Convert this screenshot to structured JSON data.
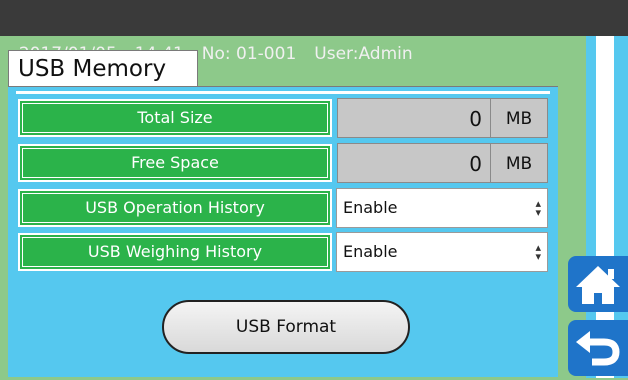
{
  "header": {
    "date": "2017/01/05",
    "time": "14:41",
    "number": "No: 01-001",
    "user": "User:Admin"
  },
  "tab": {
    "label": "USB Memory"
  },
  "fields": {
    "total_size": {
      "label": "Total Size",
      "value": "0",
      "unit": "MB"
    },
    "free_space": {
      "label": "Free Space",
      "value": "0",
      "unit": "MB"
    },
    "operation_history": {
      "label": "USB Operation History",
      "value": "Enable"
    },
    "weighing_history": {
      "label": "USB Weighing History",
      "value": "Enable"
    }
  },
  "format_button": {
    "label": "USB Format"
  },
  "nav": {
    "home_icon": "home-icon",
    "back_icon": "return-icon"
  },
  "colors": {
    "background": "#8dc98a",
    "panel": "#55c8ef",
    "label_green": "#2bb34a",
    "nav_blue": "#1f74c9",
    "titlebar": "#3a3a3a"
  }
}
